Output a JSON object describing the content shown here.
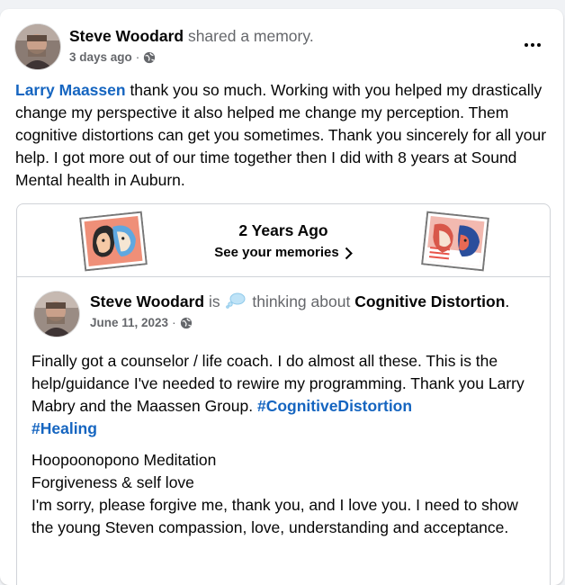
{
  "post": {
    "author": "Steve Woodard",
    "action": "shared a memory.",
    "timestamp": "3 days ago",
    "separator": "·",
    "audience_icon": "globe-icon",
    "more_icon": "more-horizontal-icon",
    "text_mention": "Larry Maassen",
    "text_body": " thank you so much. Working with you helped my drastically change my perspective it also helped me change my perception. Them cognitive distortions can get you sometimes. Thank you sincerely for all your help. I got more out of our time together then I did with 8 years at Sound Mental health in Auburn."
  },
  "memory": {
    "title": "2 Years Ago",
    "link": "See your memories",
    "chevron_icon": "chevron-right-icon",
    "left_image": "illustration-two-faces",
    "right_image": "illustration-couple-kissing"
  },
  "shared_post": {
    "author": "Steve Woodard",
    "is_text": "is",
    "feeling_icon": "thought-bubble-icon",
    "feeling_text": "thinking about",
    "topic": "Cognitive Distortion",
    "period": ".",
    "date": "June 11, 2023",
    "separator": "·",
    "audience_icon": "globe-icon",
    "para1_text": "Finally got a counselor / life coach. I do almost all these. This is the help/guidance I've needed to rewire my programming. Thank you Larry Mabry and the Maassen Group. ",
    "hashtag1": "#CognitiveDistortion",
    "hashtag2": "#Healing",
    "line1": "Hoopoonopono Meditation",
    "line2": "Forgiveness & self love",
    "line3": "I'm sorry, please forgive me, thank you, and I love you. I need to show the young Steven compassion, love, understanding and acceptance."
  },
  "colors": {
    "link_blue": "#1565c0",
    "muted_gray": "#65676b",
    "page_bg": "#f0f2f5"
  }
}
